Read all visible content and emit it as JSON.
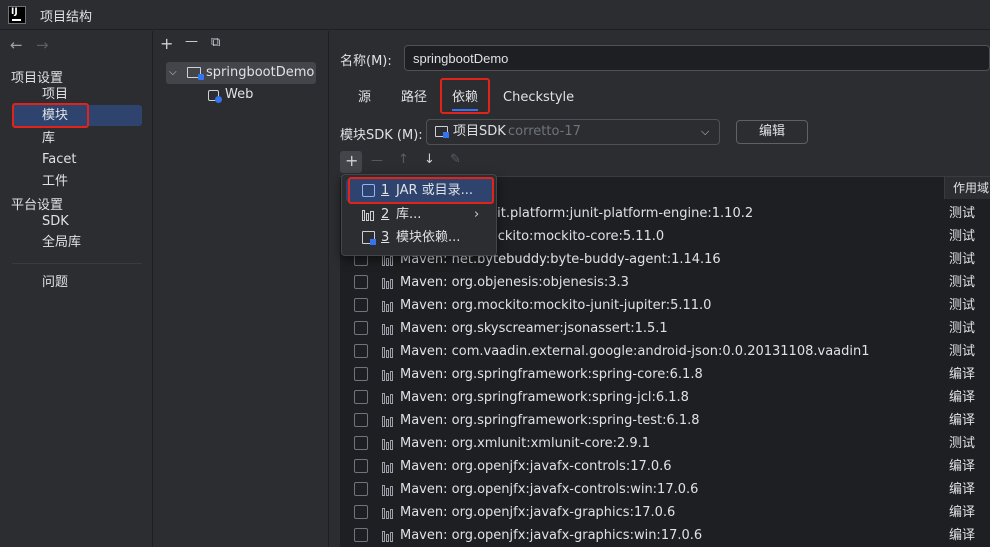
{
  "window": {
    "title": "项目结构"
  },
  "app_logo": "IJ",
  "nav": {
    "back_glyph": "←",
    "forward_glyph": "→",
    "project_settings_header": "项目设置",
    "project_settings": [
      {
        "label": "项目",
        "selected": false
      },
      {
        "label": "模块",
        "selected": true
      },
      {
        "label": "库",
        "selected": false
      },
      {
        "label": "Facet",
        "selected": false
      },
      {
        "label": "工件",
        "selected": false
      }
    ],
    "platform_settings_header": "平台设置",
    "platform_settings": [
      {
        "label": "SDK"
      },
      {
        "label": "全局库"
      }
    ],
    "problems_label": "问题"
  },
  "tree": {
    "toolbar": {
      "add_glyph": "+",
      "remove_glyph": "—",
      "copy_glyph": "⧉"
    },
    "root": {
      "label": "springbootDemo",
      "expanded": true
    },
    "child": {
      "label": "Web"
    }
  },
  "module": {
    "name_label": "名称(M):",
    "name_value": "springbootDemo",
    "tabs": [
      {
        "label": "源",
        "active": false
      },
      {
        "label": "路径",
        "active": false
      },
      {
        "label": "依赖",
        "active": true
      },
      {
        "label": "Checkstyle",
        "active": false
      }
    ],
    "sdk_label": "模块SDK (M):",
    "sdk_value": "项目SDK",
    "sdk_hint": "corretto-17",
    "edit_button": "编辑"
  },
  "deps_toolbar": {
    "add": "+",
    "remove": "—",
    "up": "↑",
    "down": "↓",
    "edit": "✎"
  },
  "deps": {
    "scope_header": "作用域",
    "rows": [
      {
        "name": "Maven: org.junit.platform:junit-platform-engine:1.10.2",
        "scope": "测试"
      },
      {
        "name": "Maven: org.mockito:mockito-core:5.11.0",
        "scope": "测试"
      },
      {
        "name": "Maven: net.bytebuddy:byte-buddy-agent:1.14.16",
        "scope": "测试"
      },
      {
        "name": "Maven: org.objenesis:objenesis:3.3",
        "scope": "测试"
      },
      {
        "name": "Maven: org.mockito:mockito-junit-jupiter:5.11.0",
        "scope": "测试"
      },
      {
        "name": "Maven: org.skyscreamer:jsonassert:1.5.1",
        "scope": "测试"
      },
      {
        "name": "Maven: com.vaadin.external.google:android-json:0.0.20131108.vaadin1",
        "scope": "测试"
      },
      {
        "name": "Maven: org.springframework:spring-core:6.1.8",
        "scope": "编译"
      },
      {
        "name": "Maven: org.springframework:spring-jcl:6.1.8",
        "scope": "编译"
      },
      {
        "name": "Maven: org.springframework:spring-test:6.1.8",
        "scope": "编译"
      },
      {
        "name": "Maven: org.xmlunit:xmlunit-core:2.9.1",
        "scope": "测试"
      },
      {
        "name": "Maven: org.openjfx:javafx-controls:17.0.6",
        "scope": "编译"
      },
      {
        "name": "Maven: org.openjfx:javafx-controls:win:17.0.6",
        "scope": "编译"
      },
      {
        "name": "Maven: org.openjfx:javafx-graphics:17.0.6",
        "scope": "编译"
      },
      {
        "name": "Maven: org.openjfx:javafx-graphics:win:17.0.6",
        "scope": "编译"
      }
    ]
  },
  "popup": {
    "items": [
      {
        "num": "1",
        "label": "JAR 或目录...",
        "icon": "jar-icon",
        "highlighted": true
      },
      {
        "num": "2",
        "label": "库...",
        "icon": "library-icon",
        "submenu": true
      },
      {
        "num": "3",
        "label": "模块依赖...",
        "icon": "module-icon"
      }
    ],
    "submenu_glyph": "›"
  },
  "colors": {
    "background": "#2b2d30",
    "selection": "#2e436e",
    "highlight_box": "#e2231a",
    "accent": "#3574f0"
  }
}
